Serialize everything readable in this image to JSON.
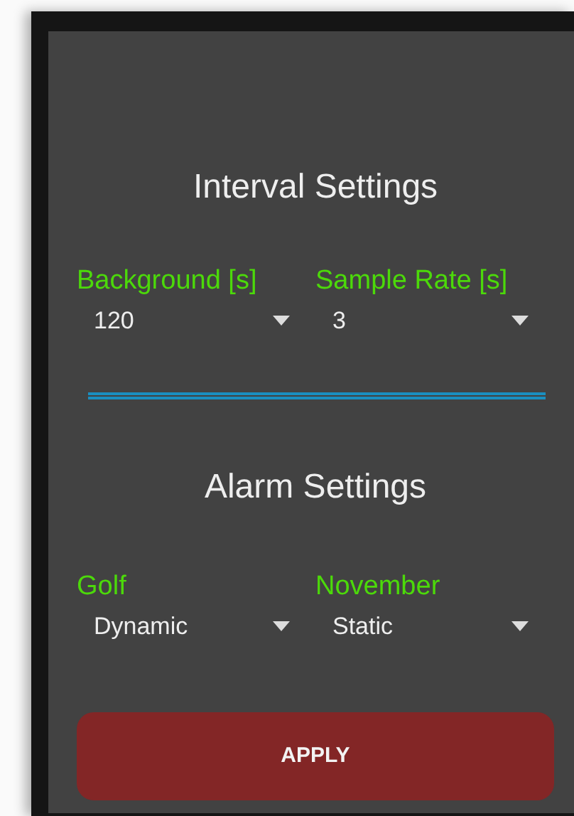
{
  "interval_settings": {
    "title": "Interval Settings",
    "fields": [
      {
        "label": "Background [s]",
        "value": "120"
      },
      {
        "label": "Sample Rate [s]",
        "value": "3"
      }
    ]
  },
  "alarm_settings": {
    "title": "Alarm Settings",
    "fields": [
      {
        "label": "Golf",
        "value": "Dynamic"
      },
      {
        "label": "November",
        "value": "Static"
      }
    ]
  },
  "apply_button": "APPLY"
}
